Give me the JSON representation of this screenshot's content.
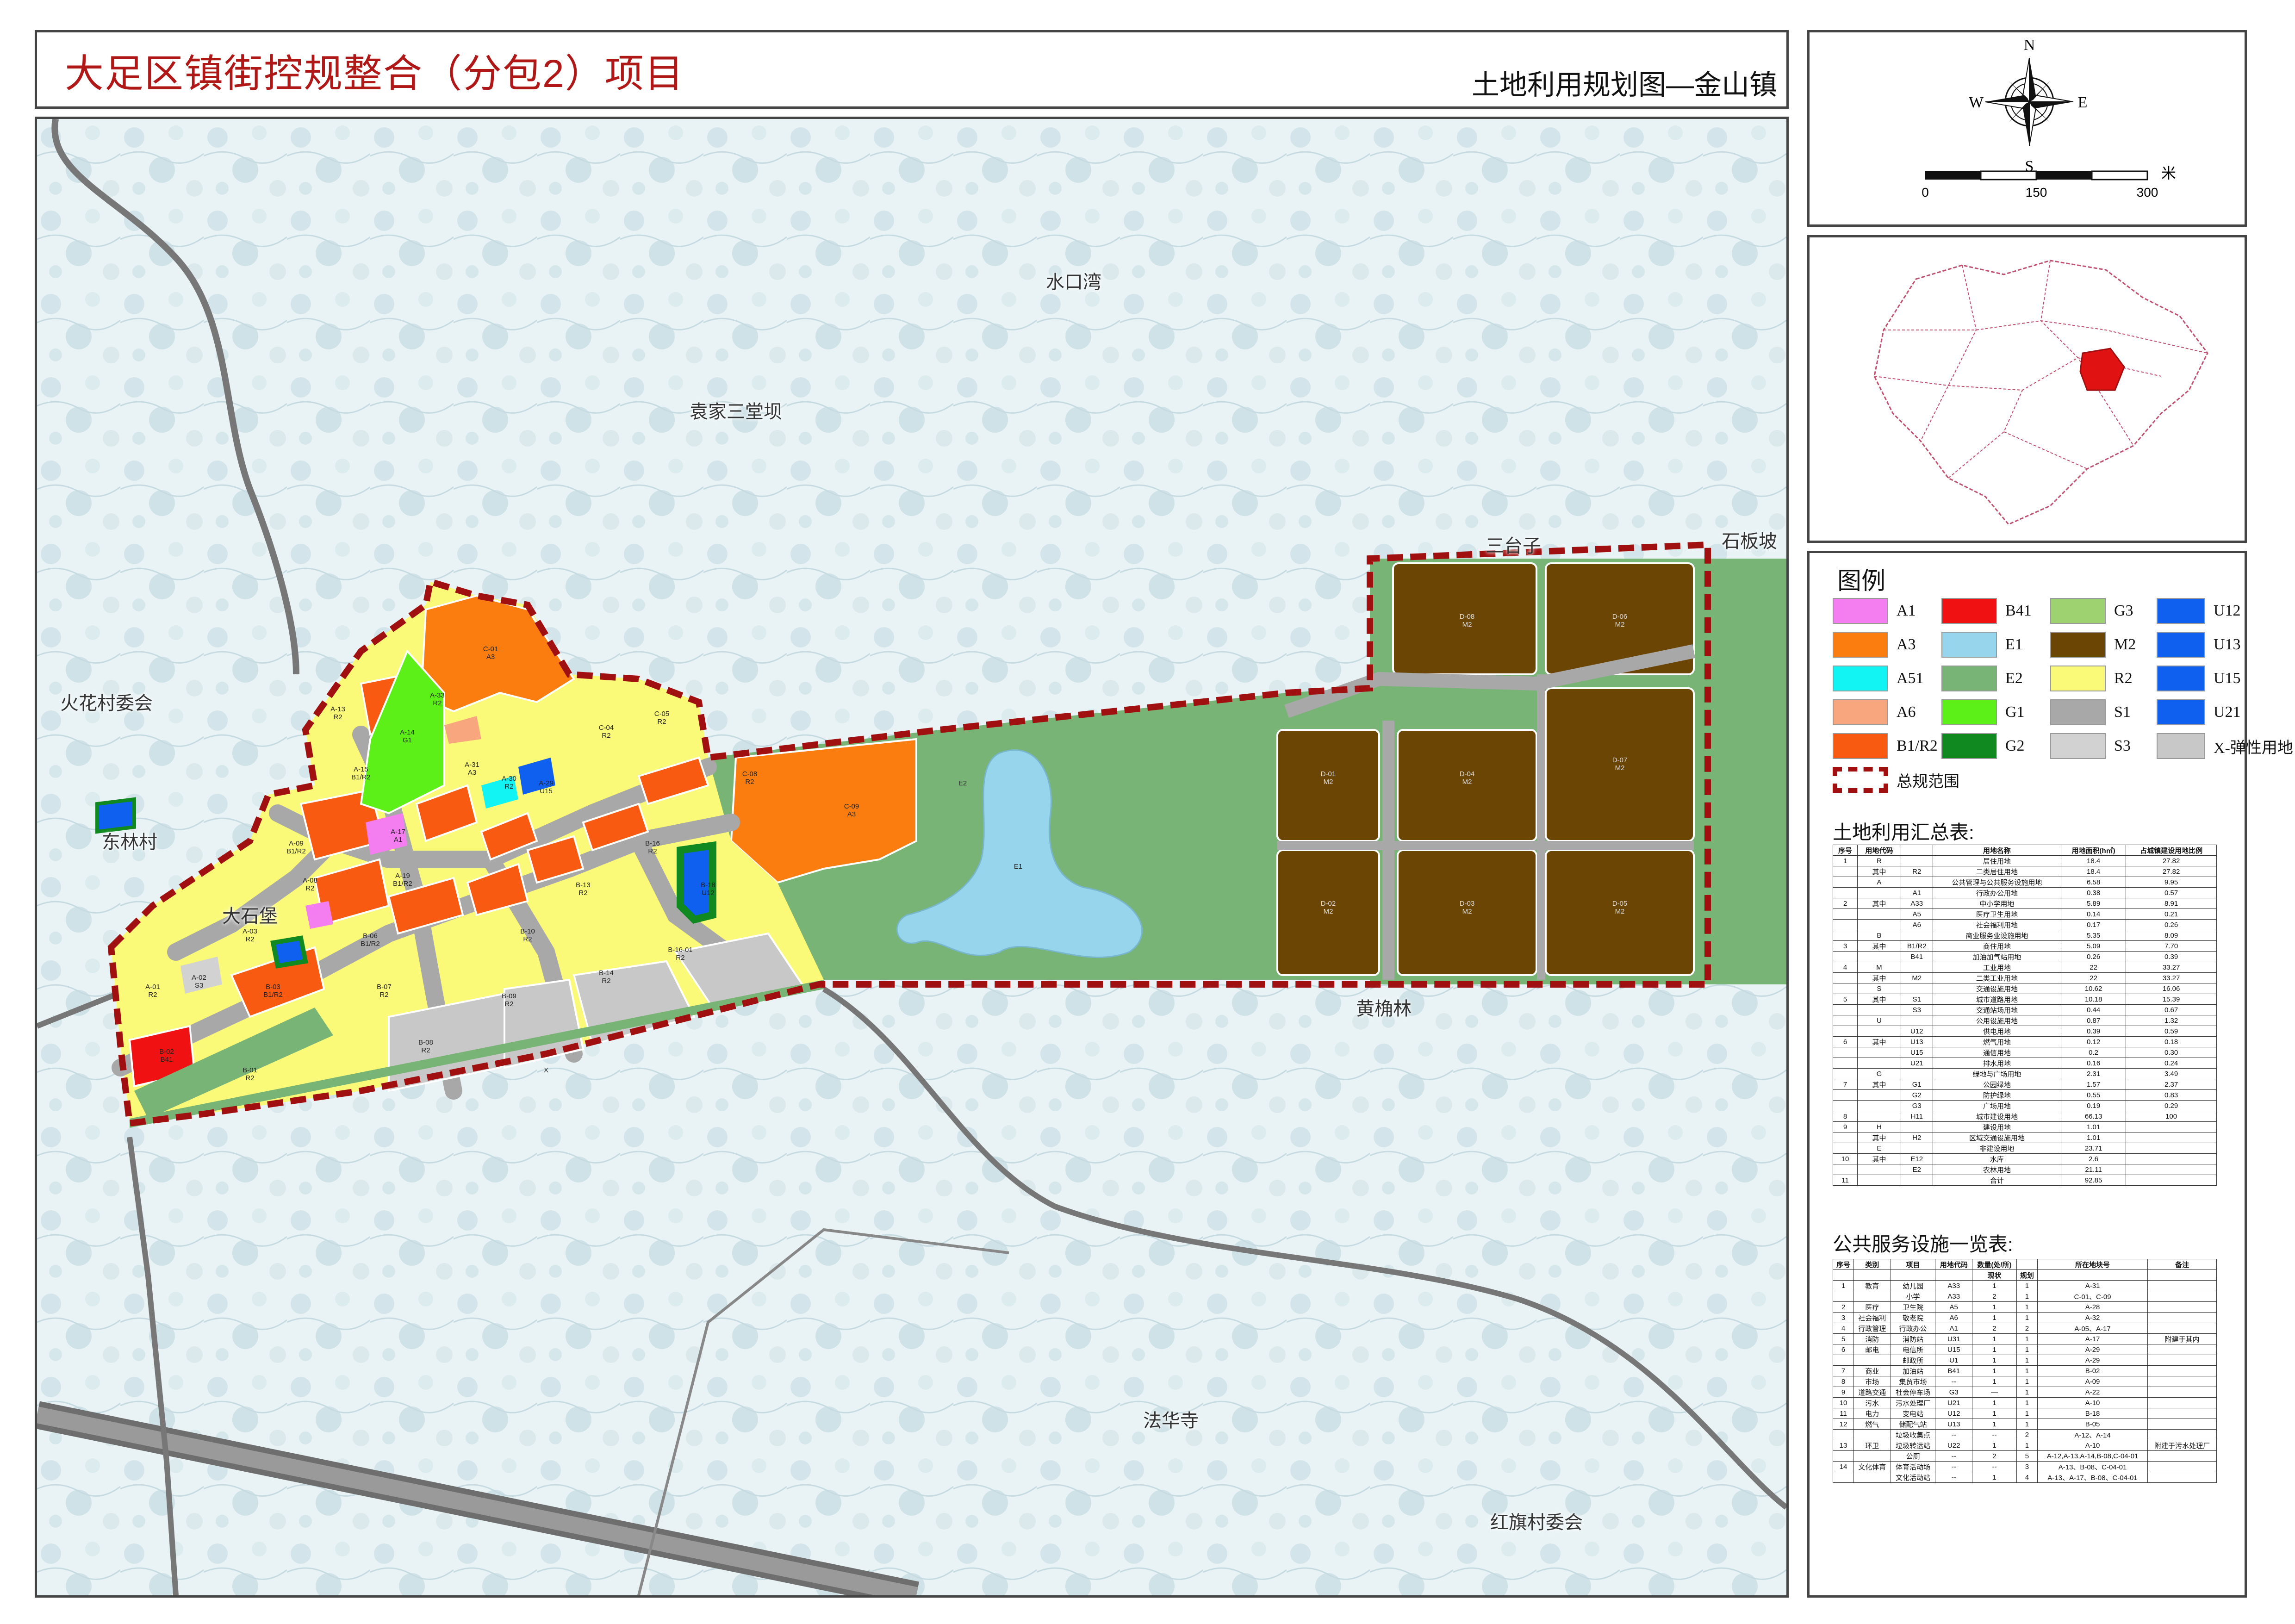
{
  "title": {
    "main": "大足区镇街控规整合（分包2）项目",
    "sub": "土地利用规划图—金山镇"
  },
  "compass": {
    "n": "N",
    "s": "S",
    "e": "E",
    "w": "W"
  },
  "scalebar": {
    "unit": "米",
    "ticks": [
      "0",
      "150",
      "300"
    ]
  },
  "legend": {
    "title": "图例",
    "items": [
      {
        "code": "A1",
        "color": "#f47ef0"
      },
      {
        "code": "A3",
        "color": "#fb7d10"
      },
      {
        "code": "A51",
        "color": "#12f3f3"
      },
      {
        "code": "A6",
        "color": "#f8a67e"
      },
      {
        "code": "B1/R2",
        "color": "#f85a12"
      },
      {
        "code": "B41",
        "color": "#f01212"
      },
      {
        "code": "E1",
        "color": "#96d5ec"
      },
      {
        "code": "E2",
        "color": "#78b475"
      },
      {
        "code": "G1",
        "color": "#5cf018"
      },
      {
        "code": "G2",
        "color": "#108a20"
      },
      {
        "code": "G3",
        "color": "#9ed170"
      },
      {
        "code": "M2",
        "color": "#6b4504"
      },
      {
        "code": "R2",
        "color": "#fafa78"
      },
      {
        "code": "S1",
        "color": "#a8a8a8"
      },
      {
        "code": "S3",
        "color": "#d2d2d2"
      },
      {
        "code": "U12",
        "color": "#1060f0"
      },
      {
        "code": "U13",
        "color": "#1060f0"
      },
      {
        "code": "U15",
        "color": "#1060f0"
      },
      {
        "code": "U21",
        "color": "#1060f0"
      },
      {
        "code": "X-弹性用地",
        "color": "#c8c8c8"
      }
    ],
    "boundary_label": "总规范围",
    "boundary_color": "#a01010"
  },
  "places": [
    {
      "name": "水口湾"
    },
    {
      "name": "袁家三堂坝"
    },
    {
      "name": "火花村委会"
    },
    {
      "name": "东林村"
    },
    {
      "name": "大石堡"
    },
    {
      "name": "三台子"
    },
    {
      "name": "石板坡"
    },
    {
      "name": "黄桷林"
    },
    {
      "name": "法华寺"
    },
    {
      "name": "红旗村委会"
    }
  ],
  "parcel_labels": [
    {
      "id": "A-13",
      "use": "R2"
    },
    {
      "id": "A-14",
      "use": "G1"
    },
    {
      "id": "A-33",
      "use": "R2"
    },
    {
      "id": "C-01",
      "use": "A3"
    },
    {
      "id": "A-15",
      "use": "B1/R2"
    },
    {
      "id": "A-31",
      "use": "A3"
    },
    {
      "id": "A-30",
      "use": "R2"
    },
    {
      "id": "A-29",
      "use": "U15"
    },
    {
      "id": "C-04",
      "use": "R2"
    },
    {
      "id": "C-05",
      "use": "R2"
    },
    {
      "id": "C-09",
      "use": "A3"
    },
    {
      "id": "C-08",
      "use": "R2"
    },
    {
      "id": "A-09",
      "use": "B1/R2"
    },
    {
      "id": "A-17",
      "use": "A1"
    },
    {
      "id": "A-08",
      "use": "R2"
    },
    {
      "id": "A-19",
      "use": "B1/R2"
    },
    {
      "id": "B-16",
      "use": "R2"
    },
    {
      "id": "B-18",
      "use": "U12"
    },
    {
      "id": "B-13",
      "use": "R2"
    },
    {
      "id": "B-10",
      "use": "R2"
    },
    {
      "id": "B-06",
      "use": "B1/R2"
    },
    {
      "id": "B-07",
      "use": "R2"
    },
    {
      "id": "B-09",
      "use": "R2"
    },
    {
      "id": "B-14",
      "use": "R2"
    },
    {
      "id": "B-16-01",
      "use": "R2"
    },
    {
      "id": "B-08",
      "use": "R2"
    },
    {
      "id": "B-01",
      "use": "R2"
    },
    {
      "id": "B-02",
      "use": "B41"
    },
    {
      "id": "B-03",
      "use": "B1/R2"
    },
    {
      "id": "A-01",
      "use": "R2"
    },
    {
      "id": "A-02",
      "use": "S3"
    },
    {
      "id": "A-03",
      "use": "R2"
    },
    {
      "id": "E1",
      "use": ""
    },
    {
      "id": "E2",
      "use": ""
    },
    {
      "id": "X",
      "use": ""
    },
    {
      "id": "D-01",
      "use": "M2"
    },
    {
      "id": "D-02",
      "use": "M2"
    },
    {
      "id": "D-03",
      "use": "M2"
    },
    {
      "id": "D-04",
      "use": "M2"
    },
    {
      "id": "D-05",
      "use": "M2"
    },
    {
      "id": "D-06",
      "use": "M2"
    },
    {
      "id": "D-07",
      "use": "M2"
    },
    {
      "id": "D-08",
      "use": "M2"
    }
  ],
  "land_summary": {
    "title": "土地利用汇总表:",
    "headers": [
      "序号",
      "用地代码",
      "",
      "用地名称",
      "用地面积(h㎡)",
      "占城镇建设用地比例"
    ],
    "rows": [
      [
        "1",
        "R",
        "",
        "居住用地",
        "18.4",
        "27.82"
      ],
      [
        "",
        "其中",
        "R2",
        "二类居住用地",
        "18.4",
        "27.82"
      ],
      [
        "",
        "A",
        "",
        "公共管理与公共服务设施用地",
        "6.58",
        "9.95"
      ],
      [
        "",
        "",
        "A1",
        "行政办公用地",
        "0.38",
        "0.57"
      ],
      [
        "2",
        "其中",
        "A33",
        "中小学用地",
        "5.89",
        "8.91"
      ],
      [
        "",
        "",
        "A5",
        "医疗卫生用地",
        "0.14",
        "0.21"
      ],
      [
        "",
        "",
        "A6",
        "社会福利用地",
        "0.17",
        "0.26"
      ],
      [
        "",
        "B",
        "",
        "商业服务业设施用地",
        "5.35",
        "8.09"
      ],
      [
        "3",
        "其中",
        "B1/R2",
        "商住用地",
        "5.09",
        "7.70"
      ],
      [
        "",
        "",
        "B41",
        "加油加气站用地",
        "0.26",
        "0.39"
      ],
      [
        "4",
        "M",
        "",
        "工业用地",
        "22",
        "33.27"
      ],
      [
        "",
        "其中",
        "M2",
        "二类工业用地",
        "22",
        "33.27"
      ],
      [
        "",
        "S",
        "",
        "交通设施用地",
        "10.62",
        "16.06"
      ],
      [
        "5",
        "其中",
        "S1",
        "城市道路用地",
        "10.18",
        "15.39"
      ],
      [
        "",
        "",
        "S3",
        "交通站场用地",
        "0.44",
        "0.67"
      ],
      [
        "",
        "U",
        "",
        "公用设施用地",
        "0.87",
        "1.32"
      ],
      [
        "",
        "",
        "U12",
        "供电用地",
        "0.39",
        "0.59"
      ],
      [
        "6",
        "其中",
        "U13",
        "燃气用地",
        "0.12",
        "0.18"
      ],
      [
        "",
        "",
        "U15",
        "通信用地",
        "0.2",
        "0.30"
      ],
      [
        "",
        "",
        "U21",
        "排水用地",
        "0.16",
        "0.24"
      ],
      [
        "",
        "G",
        "",
        "绿地与广场用地",
        "2.31",
        "3.49"
      ],
      [
        "7",
        "其中",
        "G1",
        "公园绿地",
        "1.57",
        "2.37"
      ],
      [
        "",
        "",
        "G2",
        "防护绿地",
        "0.55",
        "0.83"
      ],
      [
        "",
        "",
        "G3",
        "广场用地",
        "0.19",
        "0.29"
      ],
      [
        "8",
        "",
        "H11",
        "城市建设用地",
        "66.13",
        "100"
      ],
      [
        "9",
        "H",
        "",
        "建设用地",
        "1.01",
        ""
      ],
      [
        "",
        "其中",
        "H2",
        "区域交通设施用地",
        "1.01",
        ""
      ],
      [
        "",
        "E",
        "",
        "非建设用地",
        "23.71",
        ""
      ],
      [
        "10",
        "其中",
        "E12",
        "水库",
        "2.6",
        ""
      ],
      [
        "",
        "",
        "E2",
        "农林用地",
        "21.11",
        ""
      ],
      [
        "11",
        "",
        "",
        "合计",
        "92.85",
        ""
      ]
    ]
  },
  "facility_summary": {
    "title": "公共服务设施一览表:",
    "headers": [
      "序号",
      "类别",
      "项目",
      "用地代码",
      "数量(处/所)",
      "",
      "所在地块号",
      "备注"
    ],
    "subheaders": [
      "现状",
      "规划"
    ],
    "rows": [
      [
        "1",
        "教育",
        "幼儿园",
        "A33",
        "1",
        "1",
        "A-31",
        ""
      ],
      [
        "",
        "",
        "小学",
        "A33",
        "2",
        "1",
        "C-01、C-09",
        ""
      ],
      [
        "2",
        "医疗",
        "卫生院",
        "A5",
        "1",
        "1",
        "A-28",
        ""
      ],
      [
        "3",
        "社会福利",
        "敬老院",
        "A6",
        "1",
        "1",
        "A-32",
        ""
      ],
      [
        "4",
        "行政管理",
        "行政办公",
        "A1",
        "2",
        "2",
        "A-05、A-17",
        ""
      ],
      [
        "5",
        "消防",
        "消防站",
        "U31",
        "1",
        "1",
        "A-17",
        "附建于其内"
      ],
      [
        "6",
        "邮电",
        "电信所",
        "U15",
        "1",
        "1",
        "A-29",
        ""
      ],
      [
        "",
        "",
        "邮政所",
        "U1",
        "1",
        "1",
        "A-29",
        ""
      ],
      [
        "7",
        "商业",
        "加油站",
        "B41",
        "1",
        "1",
        "B-02",
        ""
      ],
      [
        "8",
        "市场",
        "集贸市场",
        "--",
        "1",
        "1",
        "A-09",
        ""
      ],
      [
        "9",
        "道路交通",
        "社会停车场",
        "G3",
        "—",
        "1",
        "A-22",
        ""
      ],
      [
        "10",
        "污水",
        "污水处理厂",
        "U21",
        "1",
        "1",
        "A-10",
        ""
      ],
      [
        "11",
        "电力",
        "变电站",
        "U12",
        "1",
        "1",
        "B-18",
        ""
      ],
      [
        "12",
        "燃气",
        "储配气站",
        "U13",
        "1",
        "1",
        "B-05",
        ""
      ],
      [
        "",
        "",
        "垃圾收集点",
        "--",
        "--",
        "2",
        "A-12、A-14",
        ""
      ],
      [
        "13",
        "环卫",
        "垃圾转运站",
        "U22",
        "1",
        "1",
        "A-10",
        "附建于污水处理厂"
      ],
      [
        "",
        "",
        "公厕",
        "--",
        "2",
        "5",
        "A-12,A-13,A-14,B-08,C-04-01",
        ""
      ],
      [
        "14",
        "文化体育",
        "体育活动场",
        "--",
        "--",
        "3",
        "A-13、B-08、C-04-01",
        ""
      ],
      [
        "",
        "",
        "文化活动站",
        "--",
        "1",
        "4",
        "A-13、A-17、B-08、C-04-01",
        ""
      ]
    ]
  }
}
